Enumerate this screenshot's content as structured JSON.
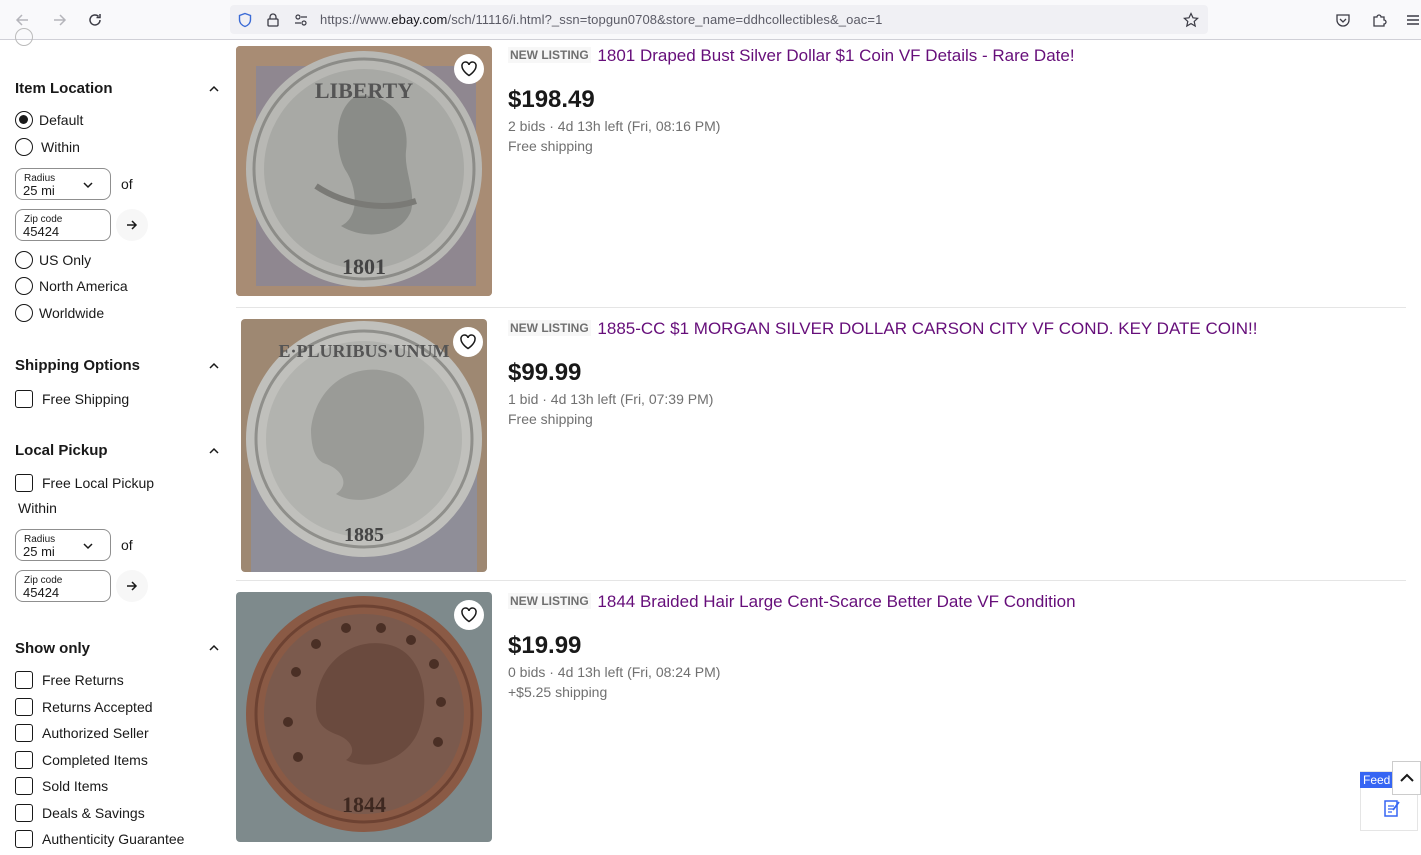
{
  "browser": {
    "url_prefix": "https://www.",
    "url_host": "ebay.com",
    "url_rest": "/sch/11116/i.html?_ssn=topgun0708&store_name=ddhcollectibles&_oac=1"
  },
  "sidebar": {
    "item_location": {
      "heading": "Item Location",
      "default_label": "Default",
      "within_label": "Within",
      "radius_label": "Radius",
      "radius_value": "25 mi",
      "of_label": "of",
      "zip_label": "Zip code",
      "zip_value": "45424",
      "us_only": "US Only",
      "north_america": "North America",
      "worldwide": "Worldwide"
    },
    "shipping_options": {
      "heading": "Shipping Options",
      "free_shipping": "Free Shipping"
    },
    "local_pickup": {
      "heading": "Local Pickup",
      "free_local_pickup": "Free Local Pickup",
      "within_label": "Within",
      "radius_label": "Radius",
      "radius_value": "25 mi",
      "of_label": "of",
      "zip_label": "Zip code",
      "zip_value": "45424"
    },
    "show_only": {
      "heading": "Show only",
      "items": [
        "Free Returns",
        "Returns Accepted",
        "Authorized Seller",
        "Completed Items",
        "Sold Items",
        "Deals & Savings",
        "Authenticity Guarantee"
      ]
    }
  },
  "listings": [
    {
      "badge": "NEW LISTING",
      "title": "1801 Draped Bust Silver Dollar $1 Coin VF Details - Rare Date!",
      "price": "$198.49",
      "meta": "2 bids · 4d 13h left (Fri, 08:16 PM)",
      "shipping": "Free shipping",
      "coin_year": "1801",
      "coin_text": "LIBERTY"
    },
    {
      "badge": "NEW LISTING",
      "title": "1885-CC $1 MORGAN SILVER DOLLAR CARSON CITY VF COND. KEY DATE COIN!!",
      "price": "$99.99",
      "meta": "1 bid · 4d 13h left (Fri, 07:39 PM)",
      "shipping": "Free shipping",
      "coin_year": "1885",
      "coin_text": "E·PLURIBUS·UNUM"
    },
    {
      "badge": "NEW LISTING",
      "title": "1844 Braided Hair Large Cent-Scarce Better Date VF Condition",
      "price": "$19.99",
      "meta": "0 bids · 4d 13h left (Fri, 08:24 PM)",
      "shipping": "+$5.25 shipping",
      "coin_year": "1844",
      "coin_text": ""
    }
  ],
  "widgets": {
    "feedback_label": "Feed"
  },
  "colors": {
    "title_visited": "#660e7a",
    "feedback_blue": "#3665f3"
  }
}
